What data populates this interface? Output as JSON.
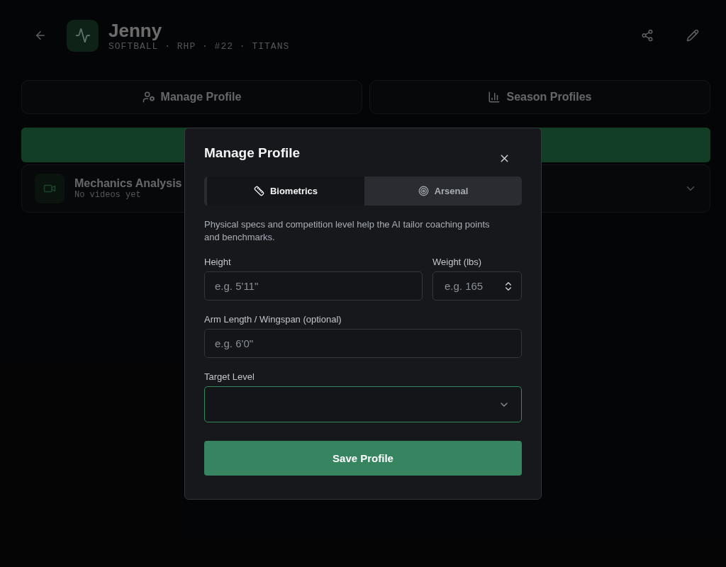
{
  "header": {
    "name": "Jenny",
    "meta": "SOFTBALL · RHP · #22 · TITANS"
  },
  "actions": [
    {
      "label": "Manage Profile",
      "kind": "profile"
    },
    {
      "label": "Season Profiles",
      "kind": "chart"
    }
  ],
  "card": {
    "title": "Mechanics Analysis",
    "subtitle": "No videos yet",
    "expanded": false
  },
  "dialog": {
    "title": "Manage Profile",
    "tabs": [
      {
        "label": "Biometrics",
        "kind": "ruler",
        "selected": true
      },
      {
        "label": "Arsenal",
        "kind": "target",
        "selected": false
      }
    ],
    "description": "Physical specs and competition level help the AI tailor coaching points and benchmarks.",
    "fields": [
      {
        "label": "Height",
        "placeholder": "e.g. 5'11\"",
        "kind": "text"
      },
      {
        "label": "Weight (lbs)",
        "placeholder": "e.g. 165",
        "kind": "number"
      },
      {
        "label": "Arm Length / Wingspan (optional)",
        "placeholder": "e.g. 6'0\"",
        "kind": "text"
      },
      {
        "label": "Target Level",
        "kind": "select"
      }
    ],
    "submit": "Save Profile"
  }
}
